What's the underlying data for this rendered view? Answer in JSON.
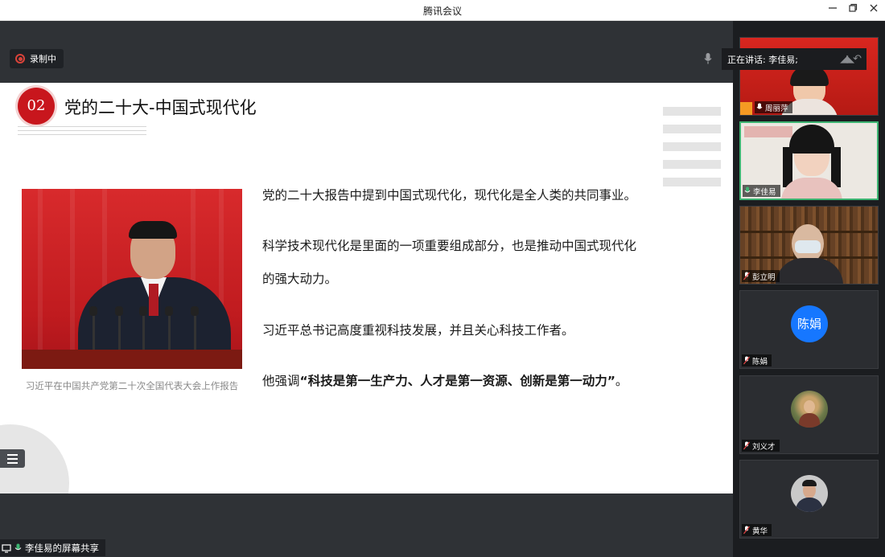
{
  "window": {
    "title": "腾讯会议",
    "controls": [
      "minimize-icon",
      "restore-icon",
      "close-icon"
    ]
  },
  "toolbar": {
    "recording_label": "录制中",
    "speaking_label": "正在讲话: 李佳易;"
  },
  "slide": {
    "badge": "02",
    "title": "党的二十大-中国式现代化",
    "photo_caption": "习近平在中国共产党第二十次全国代表大会上作报告",
    "paragraphs": [
      "党的二十大报告中提到中国式现代化，现代化是全人类的共同事业。",
      "科学技术现代化是里面的一项重要组成部分，也是推动中国式现代化",
      "的强大动力。",
      "习近平总书记高度重视科技发展，并且关心科技工作者。"
    ],
    "emphasis": {
      "prefix": "他强调",
      "bold": "“科技是第一生产力、人才是第一资源、创新是第一动力”",
      "suffix": "。"
    }
  },
  "share": {
    "label": "李佳易的屏幕共享"
  },
  "participants": [
    {
      "name": "周丽萍",
      "type": "video"
    },
    {
      "name": "李佳易",
      "type": "video",
      "active": true
    },
    {
      "name": "彭立明",
      "type": "video"
    },
    {
      "name": "陈娟",
      "type": "avatar",
      "avatar_text": "陈娟",
      "avatar_color": "#1677ff"
    },
    {
      "name": "刘义才",
      "type": "photo"
    },
    {
      "name": "黄华",
      "type": "photo"
    }
  ],
  "colors": {
    "accent_red": "#c8161d",
    "active_border": "#3cb371",
    "stage_bg": "#2f3236"
  }
}
